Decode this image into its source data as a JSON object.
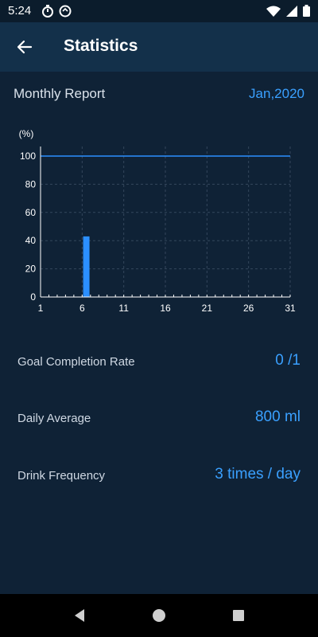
{
  "status_bar": {
    "time": "5:24"
  },
  "app_bar": {
    "title": "Statistics"
  },
  "report": {
    "title": "Monthly Report",
    "month": "Jan,2020"
  },
  "chart_data": {
    "type": "bar",
    "ylabel": "(%)",
    "xlim": [
      1,
      31
    ],
    "ylim": [
      0,
      100
    ],
    "x_ticks": [
      1,
      6,
      11,
      16,
      21,
      26,
      31
    ],
    "y_ticks": [
      0,
      20,
      40,
      60,
      80,
      100
    ],
    "goal_line": 100,
    "grid": true,
    "bars": [
      {
        "day": 6.5,
        "value": 43
      }
    ],
    "colors": {
      "bar": "#2b8fff",
      "goal_line": "#2b8fff",
      "grid": "#34475c",
      "axis": "#ffffff"
    }
  },
  "stats": [
    {
      "label": "Goal Completion Rate",
      "value": "0 /1"
    },
    {
      "label": "Daily Average",
      "value": "800 ml"
    },
    {
      "label": "Drink Frequency",
      "value": "3 times / day"
    }
  ]
}
